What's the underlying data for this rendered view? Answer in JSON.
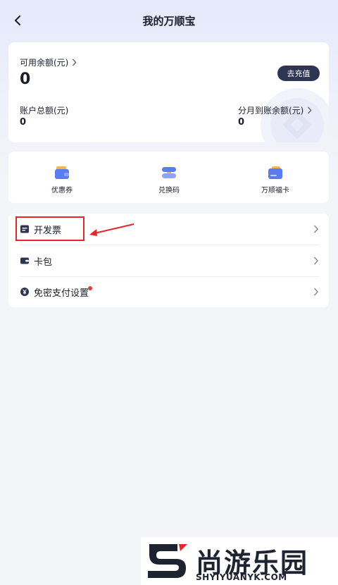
{
  "header": {
    "title": "我的万顺宝"
  },
  "balance": {
    "available_label": "可用余额(元)",
    "available_value": "0",
    "recharge_label": "去充值",
    "total_label": "账户总额(元)",
    "total_value": "0",
    "installment_label": "分月到账余额(元)",
    "installment_value": "0"
  },
  "shortcuts": [
    {
      "label": "优惠券",
      "icon": "wallet-coupon-icon"
    },
    {
      "label": "兑换码",
      "icon": "exchange-code-icon"
    },
    {
      "label": "万顺福卡",
      "icon": "fortune-card-icon"
    }
  ],
  "menu": [
    {
      "label": "开发票",
      "icon": "invoice-icon"
    },
    {
      "label": "卡包",
      "icon": "card-wallet-icon"
    },
    {
      "label": "免密支付设置",
      "icon": "yuan-coin-icon",
      "badge": true
    }
  ],
  "watermark_logo": {
    "brand": "尚游乐园",
    "url": "SHYIYUANYK.COM"
  },
  "colors": {
    "accent_dark": "#2d3552",
    "icon_blue": "#5b7bf2",
    "icon_gold": "#f3b64e",
    "annotation_red": "#e8262a",
    "badge_red": "#e43a3a"
  }
}
